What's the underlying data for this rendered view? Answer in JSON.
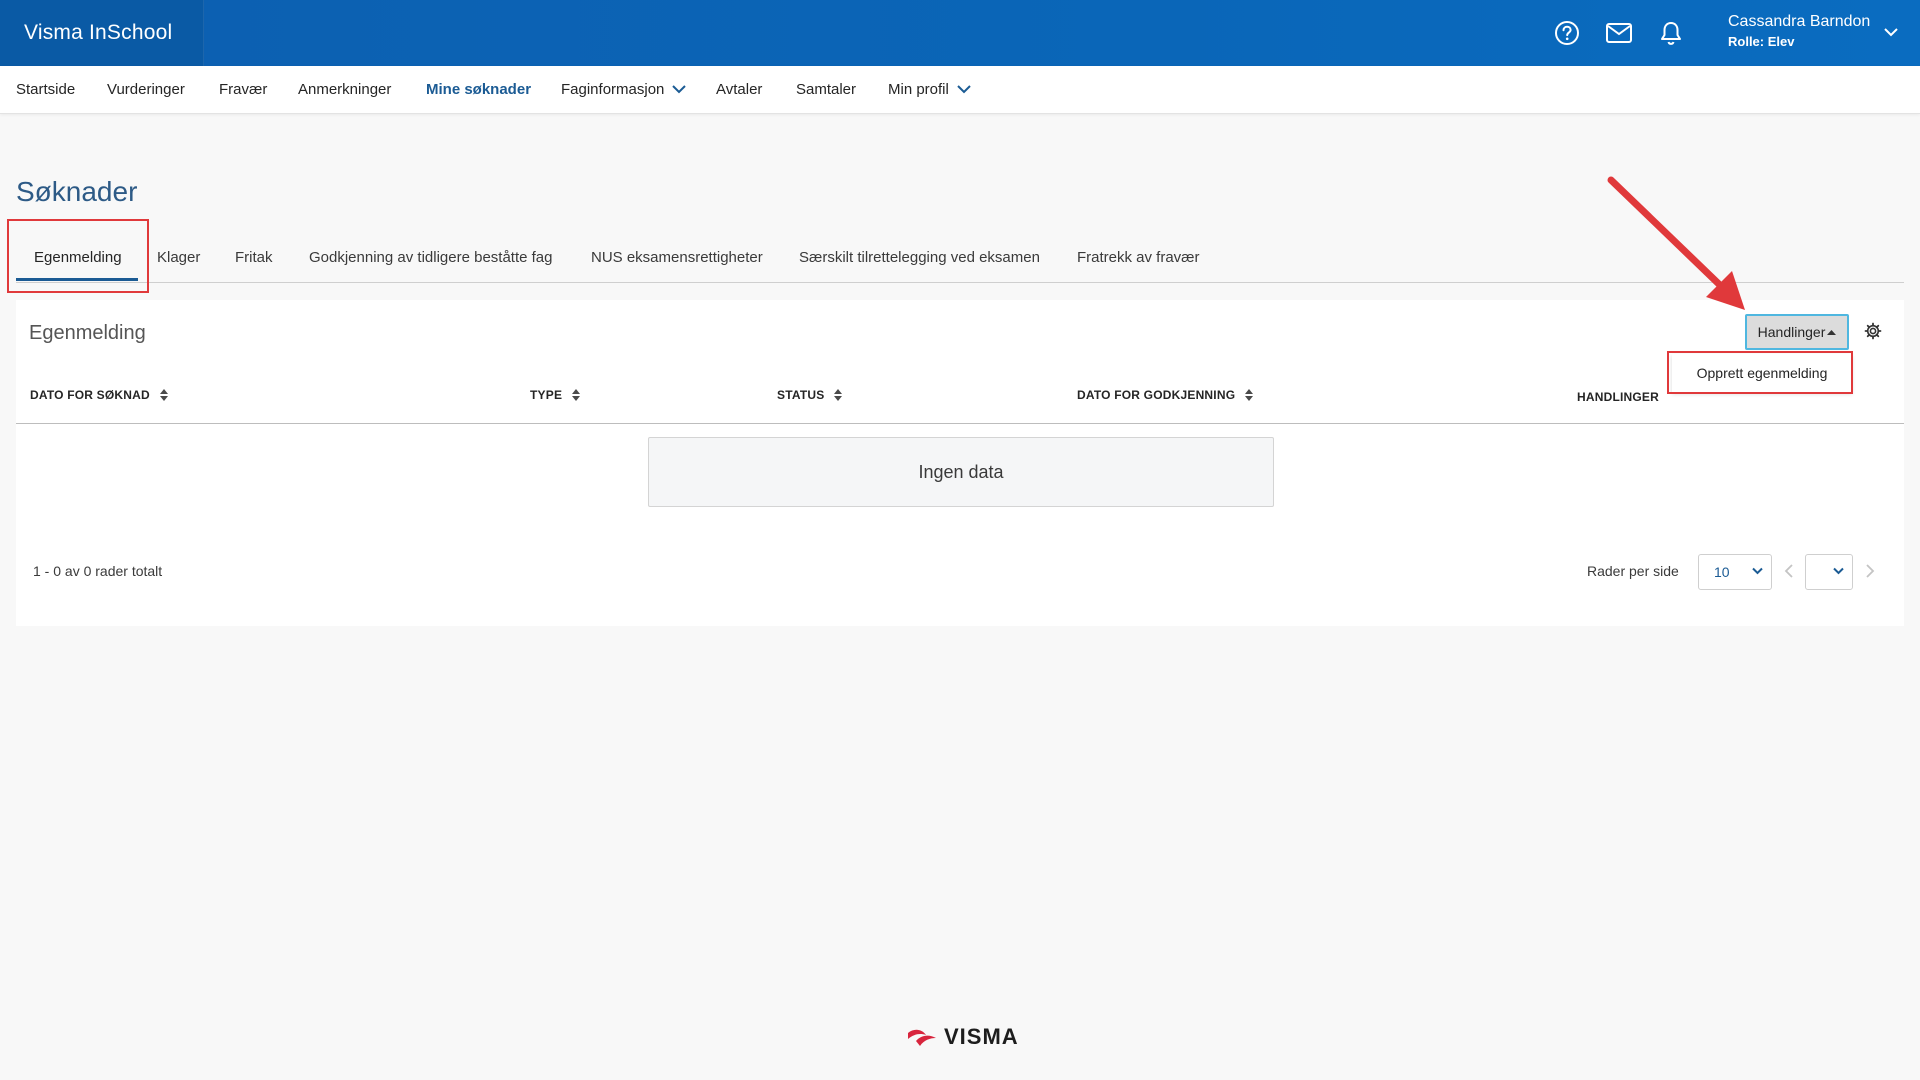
{
  "app": {
    "brand": "Visma InSchool"
  },
  "header": {
    "icons": [
      "help-icon",
      "mail-icon",
      "bell-icon"
    ],
    "user_name": "Cassandra Barndon",
    "user_role": "Rolle: Elev"
  },
  "nav": {
    "items": [
      {
        "label": "Startside"
      },
      {
        "label": "Vurderinger"
      },
      {
        "label": "Fravær"
      },
      {
        "label": "Anmerkninger"
      },
      {
        "label": "Mine søknader",
        "active": true
      },
      {
        "label": "Faginformasjon",
        "dropdown": true
      },
      {
        "label": "Avtaler"
      },
      {
        "label": "Samtaler"
      },
      {
        "label": "Min profil",
        "dropdown": true
      }
    ]
  },
  "page": {
    "title": "Søknader"
  },
  "tabs": [
    {
      "label": "Egenmelding",
      "active": true
    },
    {
      "label": "Klager"
    },
    {
      "label": "Fritak"
    },
    {
      "label": "Godkjenning av tidligere beståtte fag"
    },
    {
      "label": "NUS eksamensrettigheter"
    },
    {
      "label": "Særskilt tilrettelegging ved eksamen"
    },
    {
      "label": "Fratrekk av fravær"
    }
  ],
  "card": {
    "title": "Egenmelding",
    "actions_label": "Handlinger",
    "dropdown_item": "Opprett egenmelding",
    "columns": [
      {
        "label": "DATO FOR SØKNAD",
        "sortable": true
      },
      {
        "label": "TYPE",
        "sortable": true
      },
      {
        "label": "STATUS",
        "sortable": true
      },
      {
        "label": "DATO FOR GODKJENNING",
        "sortable": true
      },
      {
        "label": "HANDLINGER",
        "sortable": false
      }
    ],
    "empty_text": "Ingen data",
    "total_text": "1 - 0 av 0 rader totalt",
    "rows_per_page_label": "Rader per side",
    "rows_per_page_value": "10",
    "page_value": ""
  },
  "colors": {
    "header": "#0a5aa5",
    "accent": "#1b5b94",
    "annotation": "#e0393b",
    "focus": "#4fb7e0"
  },
  "footer": {
    "logo_text": "VISMA"
  }
}
